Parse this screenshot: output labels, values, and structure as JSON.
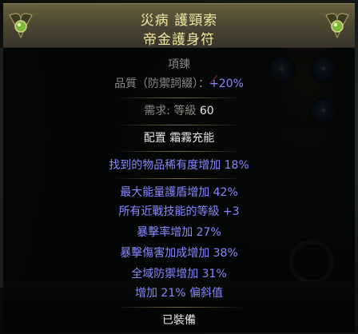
{
  "item": {
    "name_line1": "災病 護頸索",
    "name_line2": "帝金護身符",
    "type": "項鍊",
    "quality": {
      "label": "品質（防禦詞綴）：",
      "value": "+20%"
    },
    "requirement": {
      "label": "需求: 等級",
      "value": "60"
    },
    "enchant": "配置 霜霧充能",
    "implicit": "找到的物品稀有度增加 18%",
    "explicit": [
      "最大能量護盾增加 42%",
      "所有近戰技能的等級 +3",
      "暴擊率增加 27%",
      "暴擊傷害加成增加 38%",
      "全域防禦增加 31%",
      "增加 21% 偏斜值"
    ],
    "footer": "已裝備"
  },
  "colors": {
    "header_text": "#f2e5a2",
    "magic": "#8888ff",
    "label_grey": "#8c8c85",
    "white": "#e8e8e8"
  },
  "icons": {
    "corner_left": "ornament-gem-icon",
    "corner_right": "ornament-gem-icon",
    "background_orbs": "socket-orb-icon"
  }
}
